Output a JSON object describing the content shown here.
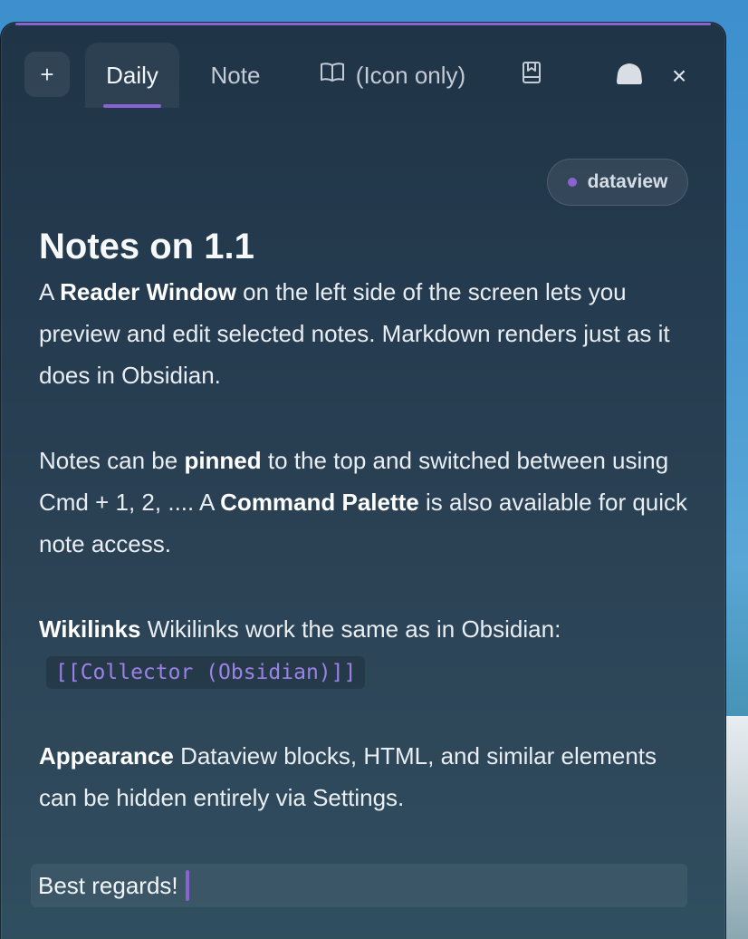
{
  "tabs": {
    "new_tab_label": "+",
    "daily_label": "Daily",
    "note_label": "Note",
    "icon_only_label": "(Icon only)",
    "close_label": "×"
  },
  "tag": {
    "label": "dataview",
    "color": "#8a63d2"
  },
  "note": {
    "title": "Notes on 1.1",
    "p1_a": "A ",
    "p1_bold": "Reader Window",
    "p1_b": " on the left side of the screen lets you preview and edit selected notes. Markdown renders just as it does in Obsidian.",
    "p2_a": "Notes can be ",
    "p2_bold1": "pinned",
    "p2_b": " to the top and switched between using Cmd + 1, 2, .... A ",
    "p2_bold2": "Command Palette",
    "p2_c": " is also available for quick note access.",
    "p3_bold": "Wikilinks",
    "p3_text": " Wikilinks work the same as in Obsidian:",
    "p3_code": "[[Collector (Obsidian)]]",
    "p4_bold": "Appearance",
    "p4_text": " Dataview blocks, HTML, and similar elements can be hidden entirely via Settings."
  },
  "editor": {
    "current_line": "Best regards!"
  },
  "icons": {
    "new_tab": "plus-icon",
    "book": "book-open-icon",
    "bookmark": "bookmark-icon",
    "cloud": "cloud-icon",
    "close": "close-icon"
  },
  "colors": {
    "accent": "#8a63d2"
  }
}
